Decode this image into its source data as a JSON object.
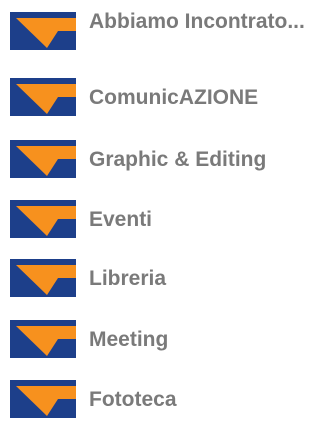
{
  "colors": {
    "icon_background": "#1d3f8a",
    "icon_accent": "#f7911e",
    "label_text": "#7a7a7a"
  },
  "menu": {
    "items": [
      {
        "label": "Abbiamo Incontrato...",
        "icon": "orange-chevron-icon"
      },
      {
        "label": "ComunicAZIONE",
        "icon": "orange-chevron-icon"
      },
      {
        "label": "Graphic & Editing",
        "icon": "orange-chevron-icon"
      },
      {
        "label": "Eventi",
        "icon": "orange-chevron-icon"
      },
      {
        "label": "Libreria",
        "icon": "orange-chevron-icon"
      },
      {
        "label": "Meeting",
        "icon": "orange-chevron-icon"
      },
      {
        "label": "Fototeca",
        "icon": "orange-chevron-icon"
      }
    ]
  }
}
